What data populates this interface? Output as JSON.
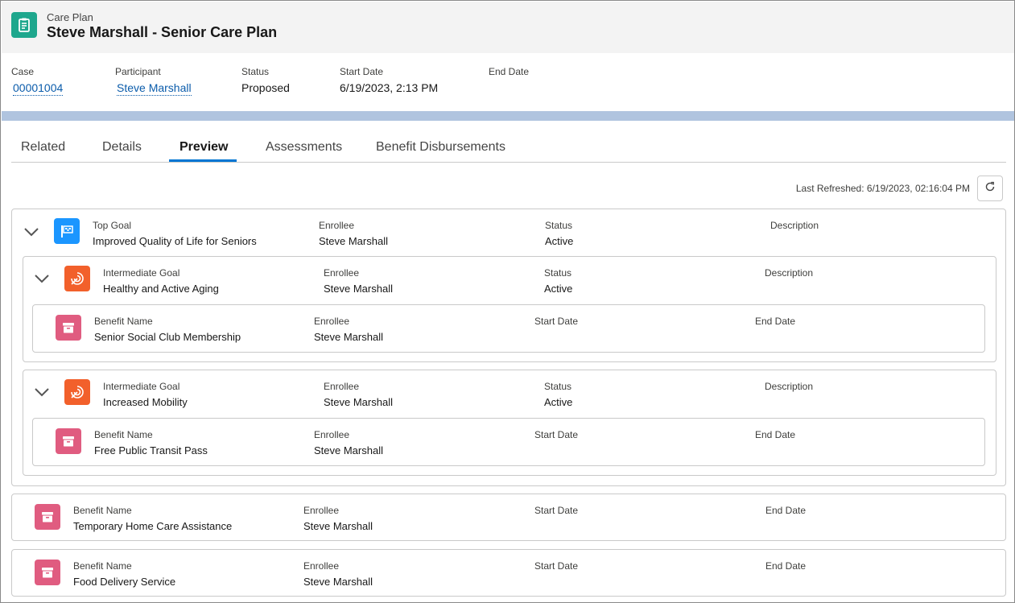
{
  "header": {
    "object_label": "Care Plan",
    "title": "Steve Marshall - Senior Care Plan",
    "icon": "care-plan-icon"
  },
  "highlights": {
    "case_label": "Case",
    "case_value": "00001004",
    "participant_label": "Participant",
    "participant_value": "Steve Marshall",
    "status_label": "Status",
    "status_value": "Proposed",
    "start_label": "Start Date",
    "start_value": "6/19/2023, 2:13 PM",
    "end_label": "End Date",
    "end_value": ""
  },
  "tabs": [
    {
      "label": "Related"
    },
    {
      "label": "Details"
    },
    {
      "label": "Preview",
      "active": true
    },
    {
      "label": "Assessments"
    },
    {
      "label": "Benefit Disbursements"
    }
  ],
  "refresh": {
    "text": "Last Refreshed: 6/19/2023, 02:16:04 PM",
    "icon": "refresh-icon"
  },
  "labels": {
    "top_goal": "Top Goal",
    "intermediate_goal": "Intermediate Goal",
    "benefit_name": "Benefit Name",
    "enrollee": "Enrollee",
    "status": "Status",
    "description": "Description",
    "start_date": "Start Date",
    "end_date": "End Date"
  },
  "top_goal": {
    "name": "Improved Quality of Life for Seniors",
    "enrollee": "Steve Marshall",
    "status": "Active",
    "description": "",
    "intermediate_goals": [
      {
        "name": "Healthy and Active Aging",
        "enrollee": "Steve Marshall",
        "status": "Active",
        "description": "",
        "benefit": {
          "name": "Senior Social Club Membership",
          "enrollee": "Steve Marshall",
          "start_date": "",
          "end_date": ""
        }
      },
      {
        "name": "Increased Mobility",
        "enrollee": "Steve Marshall",
        "status": "Active",
        "description": "",
        "benefit": {
          "name": "Free Public Transit Pass",
          "enrollee": "Steve Marshall",
          "start_date": "",
          "end_date": ""
        }
      }
    ]
  },
  "standalone_benefits": [
    {
      "name": "Temporary Home Care Assistance",
      "enrollee": "Steve Marshall",
      "start_date": "",
      "end_date": ""
    },
    {
      "name": "Food Delivery Service",
      "enrollee": "Steve Marshall",
      "start_date": "",
      "end_date": ""
    }
  ],
  "colors": {
    "header_icon": "#1ea78d",
    "goal_icon": "#1b96ff",
    "intermediate_icon": "#f2602b",
    "benefit_icon": "#e05c80",
    "link": "#0b5cab",
    "tab_active": "#0176d3"
  }
}
